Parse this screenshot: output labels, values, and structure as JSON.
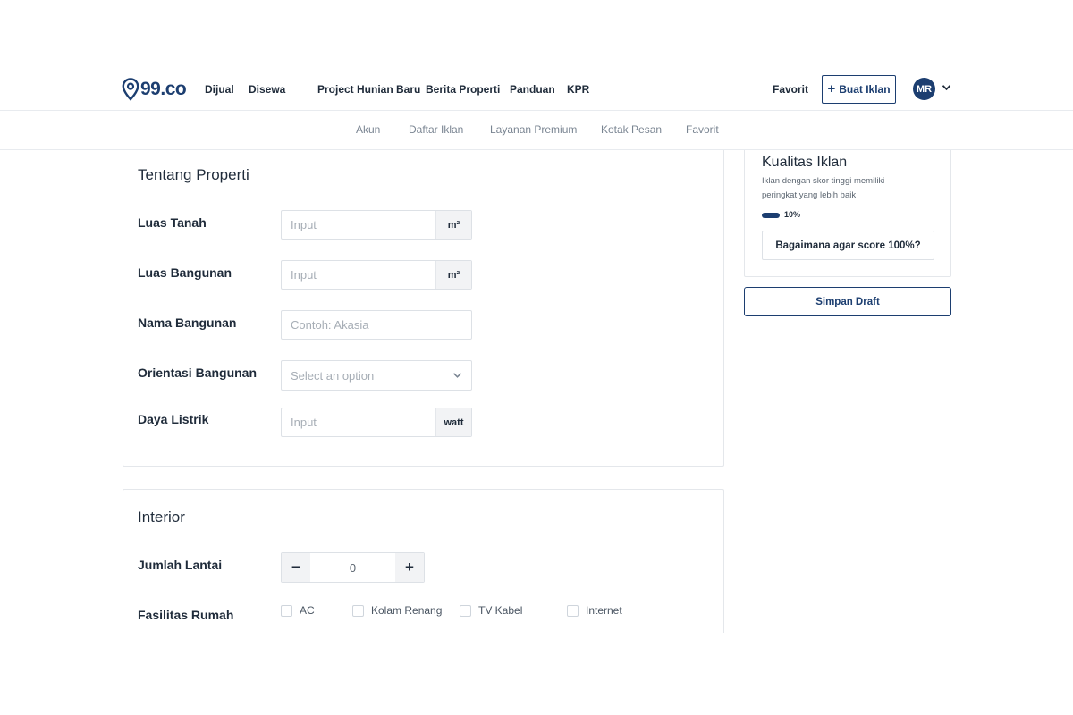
{
  "header": {
    "logo_text": "99.co",
    "nav": [
      "Dijual",
      "Disewa",
      "Project Hunian Baru",
      "Berita Properti",
      "Panduan",
      "KPR"
    ],
    "favorite_label": "Favorit",
    "post_ad_label": "Buat Iklan",
    "avatar_initials": "MR",
    "brand_color": "#1c3e70"
  },
  "subnav": [
    "Akun",
    "Daftar Iklan",
    "Layanan Premium",
    "Kotak Pesan",
    "Favorit"
  ],
  "property_section": {
    "title": "Tentang Properti",
    "land_area": {
      "label": "Luas Tanah",
      "placeholder": "Input",
      "unit": "m²"
    },
    "building_area": {
      "label": "Luas Bangunan",
      "placeholder": "Input",
      "unit": "m²"
    },
    "building_name": {
      "label": "Nama Bangunan",
      "placeholder": "Contoh: Akasia"
    },
    "orientation": {
      "label": "Orientasi Bangunan",
      "placeholder": "Select an option"
    },
    "electricity": {
      "label": "Daya Listrik",
      "placeholder": "Input",
      "unit": "watt"
    }
  },
  "interior_section": {
    "title": "Interior",
    "floors": {
      "label": "Jumlah Lantai",
      "value": "0",
      "minus": "−",
      "plus": "+"
    },
    "facilities": {
      "label": "Fasilitas Rumah",
      "options": [
        "AC",
        "Kolam Renang",
        "TV Kabel",
        "Internet"
      ]
    }
  },
  "quality": {
    "title": "Kualitas Iklan",
    "description": "Iklan dengan skor tinggi memiliki peringkat yang lebih baik",
    "score_label": "10%",
    "score_fraction": 0.1,
    "button_label": "Bagaimana agar score 100%?"
  },
  "draft_button_label": "Simpan Draft"
}
